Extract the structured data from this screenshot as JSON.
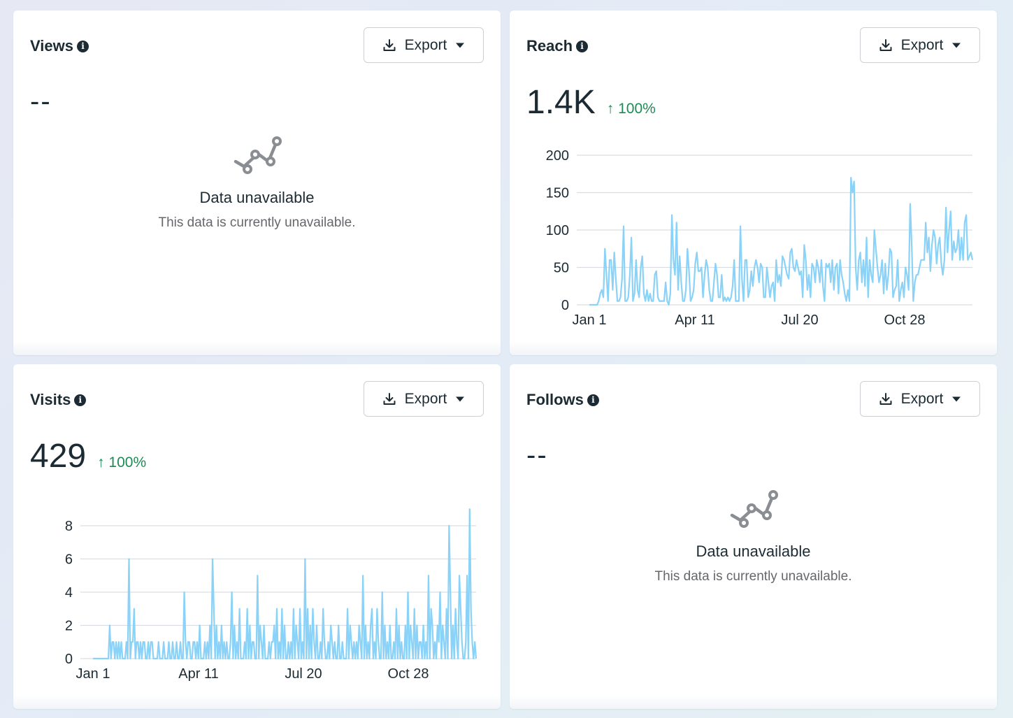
{
  "export_label": "Export",
  "info_glyph": "i",
  "cards": {
    "views": {
      "title": "Views",
      "value": "--",
      "unavailable_title": "Data unavailable",
      "unavailable_text": "This data is currently unavailable."
    },
    "reach": {
      "title": "Reach",
      "value": "1.4K",
      "change": "↑ 100%"
    },
    "visits": {
      "title": "Visits",
      "value": "429",
      "change": "↑ 100%"
    },
    "follows": {
      "title": "Follows",
      "value": "--",
      "unavailable_title": "Data unavailable",
      "unavailable_text": "This data is currently unavailable."
    }
  },
  "colors": {
    "line": "#8ad2f7",
    "positive": "#1e8a55",
    "grid": "#dadde1"
  },
  "chart_data": [
    {
      "type": "line",
      "xlabels": [
        "Jan 1",
        "Apr 11",
        "Jul 20",
        "Oct 28"
      ],
      "ylim": [
        0,
        200
      ],
      "yticks": [
        0,
        50,
        100,
        150,
        200
      ],
      "series": [
        {
          "values": [
            0,
            0,
            0,
            0,
            0,
            0,
            5,
            15,
            20,
            10,
            75,
            40,
            5,
            60,
            60,
            20,
            70,
            35,
            5,
            5,
            10,
            35,
            105,
            5,
            5,
            10,
            40,
            90,
            5,
            15,
            60,
            20,
            10,
            50,
            65,
            15,
            5,
            20,
            5,
            15,
            5,
            5,
            40,
            45,
            10,
            5,
            5,
            5,
            5,
            30,
            5,
            0,
            15,
            120,
            60,
            40,
            110,
            20,
            65,
            30,
            5,
            5,
            20,
            75,
            45,
            5,
            10,
            20,
            55,
            70,
            45,
            45,
            50,
            10,
            40,
            60,
            50,
            20,
            5,
            5,
            30,
            55,
            40,
            10,
            10,
            40,
            5,
            10,
            5,
            10,
            5,
            10,
            25,
            60,
            5,
            5,
            5,
            105,
            35,
            5,
            60,
            60,
            10,
            20,
            45,
            25,
            50,
            60,
            50,
            30,
            55,
            50,
            10,
            10,
            50,
            30,
            10,
            25,
            30,
            5,
            60,
            30,
            40,
            25,
            65,
            60,
            50,
            40,
            35,
            70,
            75,
            50,
            45,
            60,
            50,
            40,
            45,
            10,
            80,
            60,
            20,
            40,
            10,
            55,
            50,
            30,
            60,
            50,
            30,
            60,
            25,
            5,
            55,
            50,
            55,
            30,
            60,
            20,
            50,
            55,
            15,
            60,
            40,
            30,
            15,
            5,
            20,
            5,
            170,
            150,
            165,
            50,
            20,
            60,
            70,
            30,
            60,
            25,
            90,
            10,
            60,
            40,
            30,
            100,
            75,
            50,
            30,
            40,
            60,
            15,
            55,
            20,
            40,
            75,
            70,
            10,
            20,
            25,
            60,
            5,
            20,
            30,
            10,
            50,
            40,
            20,
            135,
            80,
            5,
            30,
            40,
            40,
            50,
            60,
            60,
            60,
            110,
            70,
            90,
            45,
            80,
            100,
            90,
            55,
            80,
            90,
            55,
            40,
            60,
            130,
            70,
            100,
            125,
            60,
            85,
            70,
            75,
            100,
            60,
            90,
            60,
            110,
            120,
            60,
            65,
            70,
            60
          ]
        }
      ]
    },
    {
      "type": "line",
      "xlabels": [
        "Jan 1",
        "Apr 11",
        "Jul 20",
        "Oct 28"
      ],
      "ylim": [
        0,
        8
      ],
      "yticks": [
        0,
        2,
        4,
        6,
        8
      ],
      "series": [
        {
          "values": [
            0,
            0,
            0,
            0,
            0,
            0,
            0,
            0,
            0,
            0,
            0,
            0,
            0,
            2,
            0,
            1,
            1,
            0,
            1,
            0,
            1,
            0,
            1,
            0,
            0,
            0,
            1,
            0,
            6,
            0,
            1,
            1,
            3,
            0,
            1,
            1,
            0,
            1,
            0,
            1,
            1,
            0,
            0,
            1,
            0,
            1,
            1,
            0,
            0,
            0,
            0,
            1,
            0,
            0,
            0,
            1,
            0,
            0,
            0,
            1,
            0,
            0,
            1,
            0,
            0,
            1,
            0,
            0,
            1,
            0,
            0,
            4,
            1,
            0,
            1,
            1,
            0,
            0,
            1,
            1,
            0,
            1,
            0,
            2,
            0,
            0,
            0,
            1,
            0,
            1,
            0,
            2,
            0,
            6,
            3,
            0,
            2,
            0,
            1,
            0,
            2,
            0,
            1,
            0,
            1,
            0,
            0,
            1,
            4,
            0,
            2,
            0,
            1,
            0,
            3,
            0,
            0,
            0,
            1,
            0,
            3,
            0,
            2,
            0,
            1,
            1,
            0,
            0,
            5,
            0,
            2,
            1,
            0,
            2,
            0,
            0,
            0,
            1,
            0,
            1,
            1,
            2,
            0,
            3,
            0,
            1,
            0,
            3,
            0,
            2,
            0,
            0,
            1,
            0,
            1,
            0,
            3,
            0,
            2,
            1,
            0,
            3,
            0,
            1,
            0,
            6,
            0,
            3,
            0,
            2,
            0,
            3,
            1,
            0,
            2,
            0,
            0,
            1,
            0,
            3,
            1,
            0,
            0,
            1,
            0,
            2,
            1,
            0,
            1,
            0,
            0,
            2,
            0,
            0,
            1,
            0,
            0,
            0,
            3,
            0,
            2,
            1,
            0,
            1,
            0,
            1,
            0,
            2,
            1,
            0,
            5,
            0,
            2,
            0,
            1,
            0,
            2,
            3,
            0,
            1,
            0,
            3,
            1,
            0,
            0,
            4,
            0,
            2,
            0,
            1,
            0,
            2,
            0,
            0,
            1,
            0,
            3,
            0,
            2,
            0,
            1,
            0,
            0,
            2,
            0,
            4,
            0,
            2,
            1,
            0,
            3,
            0,
            2,
            0,
            1,
            1,
            0,
            2,
            0,
            1,
            0,
            5,
            0,
            3,
            2,
            0,
            1,
            0,
            2,
            1,
            4,
            0,
            2,
            1,
            0,
            3,
            0,
            8,
            4,
            0,
            2,
            0,
            3,
            1,
            0,
            5,
            3,
            1,
            0,
            0,
            1,
            5,
            0,
            9,
            3,
            1,
            0,
            1,
            0
          ]
        }
      ]
    }
  ]
}
